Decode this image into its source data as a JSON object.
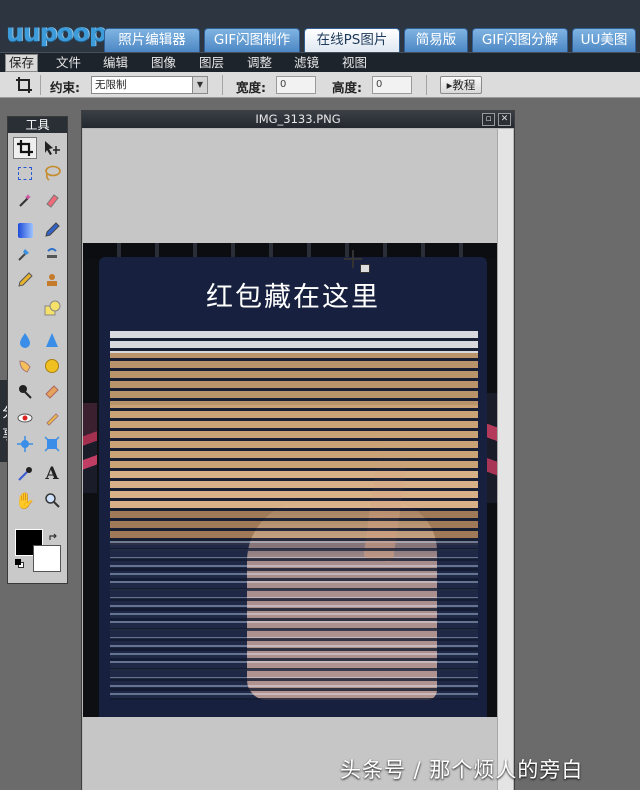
{
  "app": {
    "logo": "uupoop"
  },
  "tabs": [
    {
      "label": "照片编辑器",
      "active": false
    },
    {
      "label": "GIF闪图制作",
      "active": false
    },
    {
      "label": "在线PS图片",
      "active": true
    },
    {
      "label": "简易版",
      "active": false
    },
    {
      "label": "GIF闪图分解",
      "active": false
    },
    {
      "label": "UU美图",
      "active": false
    }
  ],
  "menu": {
    "save": "保存",
    "items": [
      "文件",
      "编辑",
      "图像",
      "图层",
      "调整",
      "滤镜",
      "视图"
    ]
  },
  "options": {
    "constraint_label": "约束:",
    "constraint_value": "无限制",
    "width_label": "宽度:",
    "width_value": "0",
    "height_label": "高度:",
    "height_value": "0",
    "tutorial_button": "▸教程"
  },
  "toolbox": {
    "title": "工具",
    "tools": [
      "crop-icon",
      "move-icon",
      "marquee-icon",
      "lasso-icon",
      "magic-wand-icon",
      "eraser-pencil-icon",
      "gradient-icon",
      "brush-icon",
      "healing-icon",
      "clone-stamp-icon",
      "pencil-icon",
      "stamp-icon",
      "shape-icon",
      "blur-icon",
      "sharpen-icon",
      "smudge-icon",
      "sponge-icon",
      "dodge-icon",
      "burn-icon",
      "red-eye-icon",
      "bloat-icon",
      "pinch-icon",
      "eyedropper-icon",
      "type-icon",
      "hand-icon",
      "zoom-icon"
    ],
    "fg_color": "#000000",
    "bg_color": "#ffffff"
  },
  "share": {
    "label": "分享"
  },
  "image_window": {
    "title": "IMG_3133.PNG",
    "card_title": "红包藏在这里"
  },
  "watermark": "头条号 / 那个烦人的旁白"
}
